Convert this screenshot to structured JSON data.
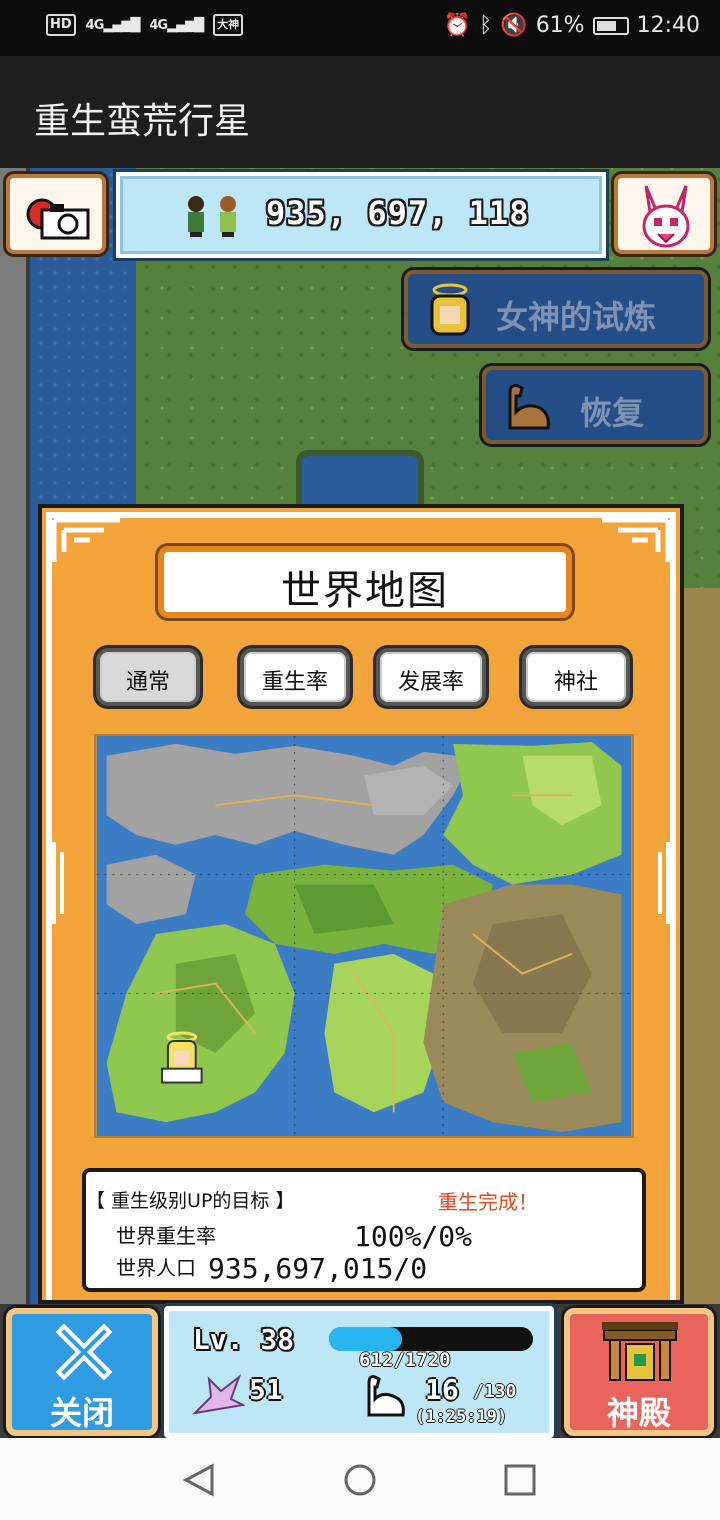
{
  "status_bar": {
    "hd": "HD",
    "signal1": "4G",
    "signal2": "4G",
    "carrier_badge": "大神",
    "battery": "61%",
    "time": "12:40"
  },
  "app": {
    "title": "重生蛮荒行星"
  },
  "hud": {
    "population": "935, 697, 118",
    "goddess_trial": "女神的试炼",
    "recover": "恢复"
  },
  "world_map": {
    "title": "世界地图",
    "tabs": [
      {
        "label": "通常",
        "active": true
      },
      {
        "label": "重生率",
        "active": false
      },
      {
        "label": "发展率",
        "active": false
      },
      {
        "label": "神社",
        "active": false
      }
    ],
    "goal_heading": "【 重生级别UP的目标 】",
    "goal_status": "重生完成！",
    "rebirth_rate_label": "世界重生率",
    "rebirth_rate_value": "100%/0%",
    "population_label": "世界人口",
    "population_value": "935,697,015/0"
  },
  "bottom": {
    "close": "关闭",
    "level": "Lv. 38",
    "xp": "612/1720",
    "xp_fraction": 0.356,
    "wings": "51",
    "stamina": "16",
    "stamina_max": "/130",
    "stamina_timer": "(1:25:19)",
    "temple": "神殿"
  },
  "colors": {
    "panel_orange": "#f2a33a",
    "close_blue": "#2f9be2",
    "temple_red": "#e9645a",
    "done_red": "#e24a22"
  }
}
